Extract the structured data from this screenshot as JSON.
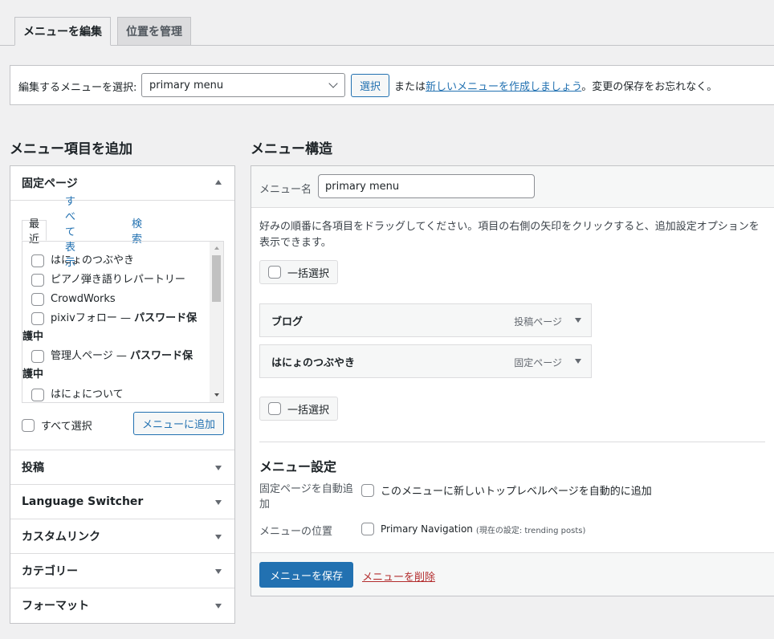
{
  "tabs": {
    "edit": "メニューを編集",
    "locations": "位置を管理"
  },
  "select_bar": {
    "label": "編集するメニューを選択:",
    "selected_menu": "primary menu",
    "select_button": "選択",
    "or_text": "または",
    "create_link": "新しいメニューを作成しましょう",
    "suffix": "。変更の保存をお忘れなく。"
  },
  "left": {
    "heading": "メニュー項目を追加",
    "pages_section": {
      "title": "固定ページ",
      "tabs": [
        "最近",
        "すべて表示",
        "検索"
      ],
      "items": [
        {
          "label": "はにょのつぶやき"
        },
        {
          "label": "ピアノ弾き語りレパートリー"
        },
        {
          "label": "CrowdWorks"
        },
        {
          "label": "pixivフォロー — ",
          "protected": "パスワード保",
          "cont": "護中"
        },
        {
          "label": "管理人ページ — ",
          "protected": "パスワード保",
          "cont": "護中"
        },
        {
          "label": "はにょについて"
        }
      ],
      "select_all": "すべて選択",
      "add_button": "メニューに追加"
    },
    "sections": [
      "投稿",
      "Language Switcher",
      "カスタムリンク",
      "カテゴリー",
      "フォーマット"
    ]
  },
  "right": {
    "heading": "メニュー構造",
    "name_label": "メニュー名",
    "name_value": "primary menu",
    "instructions_1": "好みの順番に各項目をドラッグしてください。項目の右側の矢印をクリックすると、追加設定オプションを",
    "instructions_2": "表示できます。",
    "bulk_select": "一括選択",
    "menu_items": [
      {
        "title": "ブログ",
        "type": "投稿ページ"
      },
      {
        "title": "はにょのつぶやき",
        "type": "固定ページ"
      }
    ],
    "settings": {
      "heading": "メニュー設定",
      "auto_add_label_1": "固定ページを自動追",
      "auto_add_label_2": "加",
      "auto_add_option": "このメニューに新しいトップレベルページを自動的に追加",
      "location_label": "メニューの位置",
      "location_option": "Primary Navigation",
      "location_current": "(現在の設定: trending posts)"
    },
    "save_button": "メニューを保存",
    "delete_link": "メニューを削除"
  }
}
